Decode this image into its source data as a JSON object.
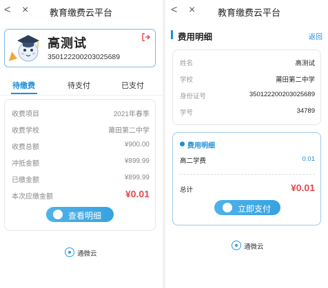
{
  "left": {
    "topbar": {
      "back_glyph": "<",
      "close_glyph": "×",
      "title": "教育缴费云平台"
    },
    "profile": {
      "name": "高测试",
      "id_number": "350122200203025689",
      "avatar_icon": "graduate-mascot-icon",
      "logout_icon": "logout-icon"
    },
    "tabs": [
      {
        "label": "待缴费",
        "active": true
      },
      {
        "label": "待支付",
        "active": false
      },
      {
        "label": "已支付",
        "active": false
      }
    ],
    "fees": [
      {
        "label": "收费项目",
        "value": "2021年春季"
      },
      {
        "label": "收费学校",
        "value": "莆田第二中学"
      },
      {
        "label": "收费总额",
        "value": "¥900.00"
      },
      {
        "label": "冲抵金额",
        "value": "¥899.99"
      },
      {
        "label": "已缴金额",
        "value": "¥899.99"
      },
      {
        "label": "本次应缴金额",
        "value": "¥0.01"
      }
    ],
    "detail_button": "查看明细",
    "brand": "通微云"
  },
  "right": {
    "topbar": {
      "back_glyph": "<",
      "close_glyph": "×",
      "title": "教育缴费云平台"
    },
    "section_title": "费用明细",
    "back_link": "返回",
    "info": [
      {
        "label": "姓名",
        "value": "高测试"
      },
      {
        "label": "学校",
        "value": "莆田第二中学"
      },
      {
        "label": "身份证号",
        "value": "350122200203025689"
      },
      {
        "label": "学号",
        "value": "34789"
      }
    ],
    "fee_detail": {
      "heading": "费用明细",
      "item_label": "高二学费",
      "item_value": "0.01",
      "total_label": "总计",
      "total_value": "¥0.01"
    },
    "pay_button": "立即支付",
    "brand": "通微云"
  },
  "colors": {
    "accent": "#1b8ed8",
    "amount_red": "#e5484d",
    "border_blue": "#7fb8e8"
  }
}
